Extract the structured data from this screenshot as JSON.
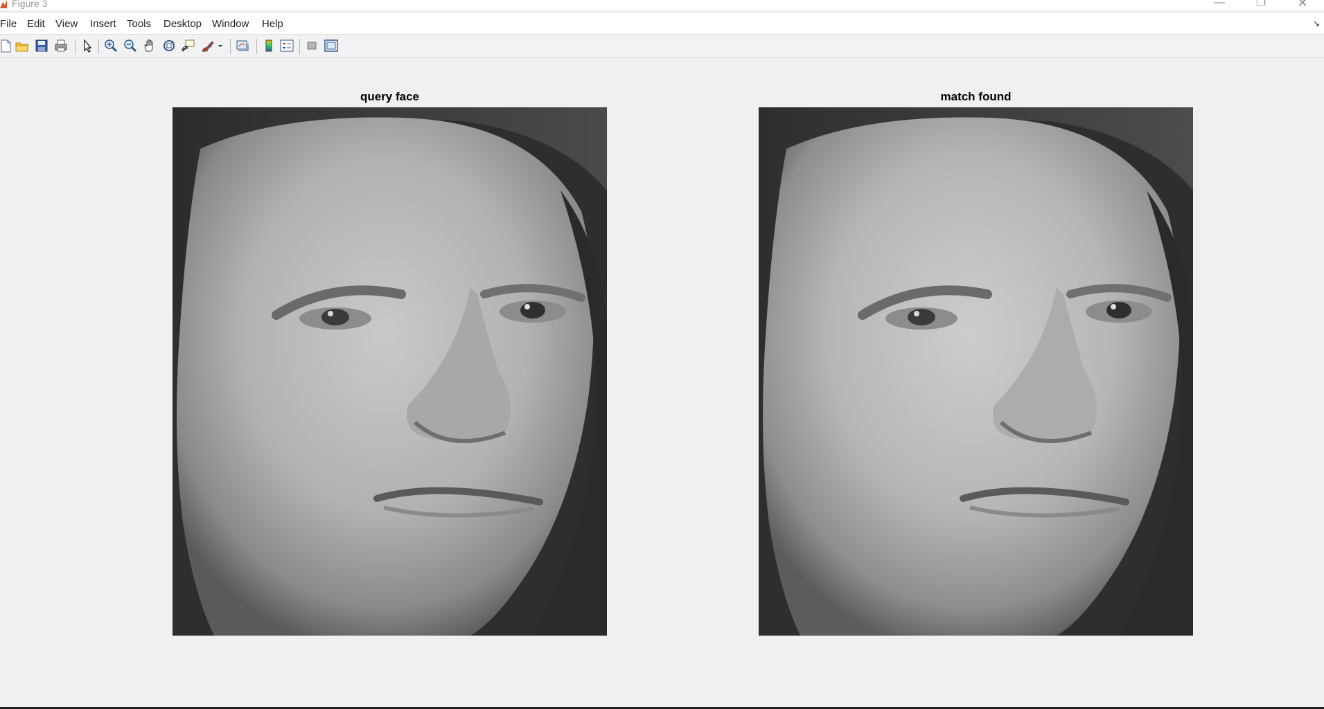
{
  "window": {
    "title": "Figure 3",
    "controls": [
      "minimize",
      "restore",
      "close"
    ]
  },
  "menu": {
    "items": [
      "File",
      "Edit",
      "View",
      "Insert",
      "Tools",
      "Desktop",
      "Window",
      "Help"
    ],
    "dock_arrow": "↘"
  },
  "toolbar": {
    "buttons": [
      "new-figure-icon",
      "open-file-icon",
      "save-icon",
      "print-icon",
      "edit-plot-icon",
      "zoom-in-icon",
      "zoom-out-icon",
      "pan-icon",
      "rotate-3d-icon",
      "data-cursor-icon",
      "brush-icon",
      "link-plot-icon",
      "colorbar-icon",
      "legend-icon",
      "hide-plot-tools-icon",
      "show-plot-tools-icon"
    ]
  },
  "axes": [
    {
      "title": "query face",
      "image": "grayscale face photograph"
    },
    {
      "title": "match found",
      "image": "grayscale face photograph"
    }
  ],
  "colors": {
    "background": "#f0f0f0",
    "menubar": "#ffffff",
    "toolbar": "#f2f2f2"
  }
}
